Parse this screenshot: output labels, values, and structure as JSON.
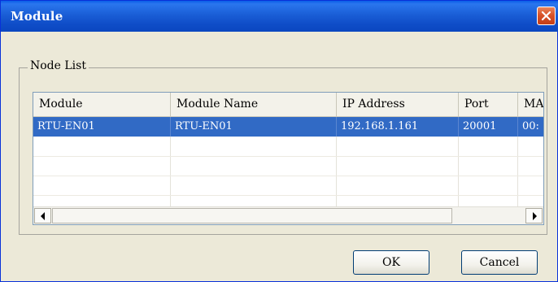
{
  "window": {
    "title": "Module"
  },
  "group": {
    "label": "Node List"
  },
  "table": {
    "columns": [
      "Module",
      "Module Name",
      "IP Address",
      "Port",
      "MA"
    ],
    "rows": [
      {
        "module": "RTU-EN01",
        "module_name": "RTU-EN01",
        "ip_address": "192.168.1.161",
        "port": "20001",
        "mac": "00:"
      }
    ]
  },
  "buttons": {
    "ok": "OK",
    "cancel": "Cancel"
  },
  "icons": {
    "close": "close-icon",
    "scroll_left": "arrow-left-icon",
    "scroll_right": "arrow-right-icon"
  },
  "colors": {
    "title_bar": "#0b4fd0",
    "selection": "#316ac5",
    "dialog_bg": "#ece9d8",
    "close_button": "#d8532a"
  }
}
